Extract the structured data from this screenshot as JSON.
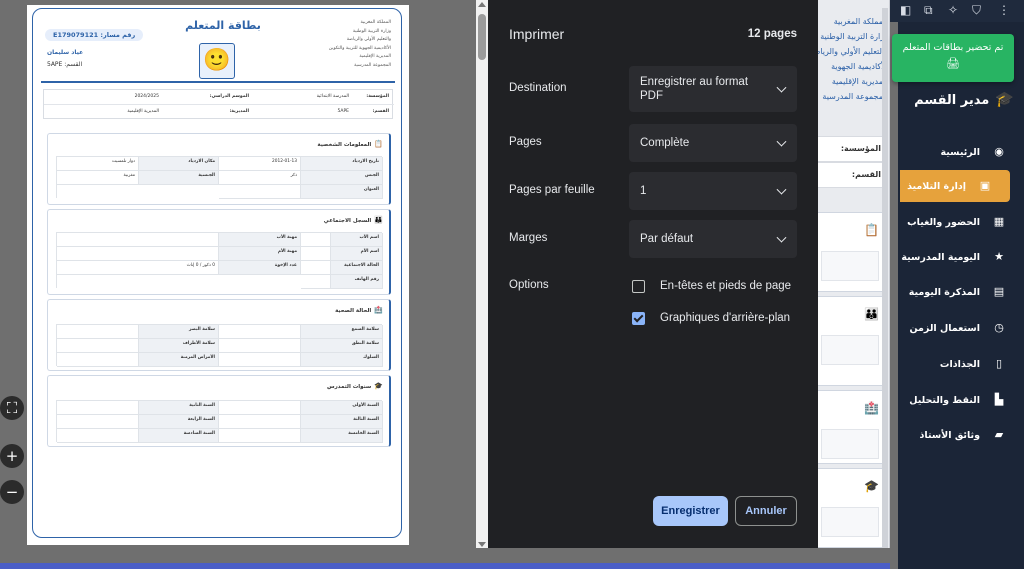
{
  "print_dialog": {
    "title": "Imprimer",
    "page_count": "12 pages",
    "destination_label": "Destination",
    "destination_value": "Enregistrer au format PDF",
    "pages_label": "Pages",
    "pages_value": "Complète",
    "pages_per_sheet_label": "Pages par feuille",
    "pages_per_sheet_value": "1",
    "margins_label": "Marges",
    "margins_value": "Par défaut",
    "options_label": "Options",
    "headers_footers_label": "En-têtes et pieds de page",
    "headers_footers_checked": false,
    "background_graphics_label": "Graphiques d'arrière-plan",
    "background_graphics_checked": true,
    "save_button": "Enregistrer",
    "cancel_button": "Annuler",
    "accent_color": "#a8c7fa"
  },
  "preview": {
    "zoom_in": "+",
    "zoom_out": "−",
    "fit": "⛶",
    "document": {
      "title": "بطاقة المتعلم",
      "registration": "رقم مسار: E179079121",
      "student_name": "عياد سليمان",
      "class_line": "القسم: 5APE",
      "ministry_lines": [
        "المملكة المغربية",
        "وزارة التربية الوطنية",
        "والتعليم الأولي والرياضة",
        "الأكاديمية الجهوية للتربية والتكوين",
        "المديرية الإقليمية",
        "المجموعة المدرسية"
      ],
      "info": {
        "school_label": "المؤسسة:",
        "school_value": "المدرسة الابتدائية",
        "year_label": "الموسم الدراسي:",
        "year_value": "2024/2025",
        "class_label": "القسم:",
        "class_value": "5APE",
        "direction_label": "المديرية:",
        "direction_value": "المديرية الإقليمية"
      },
      "sections": {
        "personal_title": "المعلومات الشخصية",
        "personal": [
          [
            "تاريخ الازدياد",
            "2012-01-13",
            "مكان الازدياد",
            "دوار تلمسيت"
          ],
          [
            "الجنس",
            "ذكر",
            "الجنسية",
            "مغربية"
          ],
          [
            "العنوان",
            "",
            "",
            ""
          ]
        ],
        "social_title": "السجل الاجتماعي",
        "social": [
          [
            "اسم الأب",
            "",
            "مهنة الأب",
            ""
          ],
          [
            "اسم الأم",
            "",
            "مهنة الأم",
            ""
          ],
          [
            "الحالة الاجتماعية",
            "",
            "عدد الإخوة",
            "0 ذكور / 0 إناث"
          ],
          [
            "رقم الهاتف",
            "",
            "",
            ""
          ]
        ],
        "health_title": "الحالة الصحية",
        "health": [
          [
            "سلامة السمع",
            "",
            "سلامة البصر",
            ""
          ],
          [
            "سلامة النطق",
            "",
            "سلامة الأطراف",
            ""
          ],
          [
            "السلوك",
            "",
            "الأمراض المزمنة",
            ""
          ]
        ],
        "schooling_title": "سنوات التمدرس",
        "schooling": [
          [
            "السنة الأولى",
            "",
            "السنة الثانية",
            ""
          ],
          [
            "السنة الثالثة",
            "",
            "السنة الرابعة",
            ""
          ],
          [
            "السنة الخامسة",
            "",
            "السنة السادسة",
            ""
          ]
        ]
      }
    }
  },
  "app": {
    "toast_text": "تم تحضير بطاقات المتعلم",
    "brand": "مدير القسم",
    "sidebar_items": [
      {
        "label": "الرئيسية",
        "icon": "dashboard-icon",
        "glyph": "◉"
      },
      {
        "label": "إدارة التلاميذ",
        "icon": "students-icon",
        "glyph": "▣",
        "active": true
      },
      {
        "label": "الحضور والغياب",
        "icon": "calendar-check-icon",
        "glyph": "▦"
      },
      {
        "label": "اليومية المدرسية",
        "icon": "star-icon",
        "glyph": "★"
      },
      {
        "label": "المذكرة اليومية",
        "icon": "notebook-icon",
        "glyph": "▤"
      },
      {
        "label": "استعمال الزمن",
        "icon": "clock-icon",
        "glyph": "◷"
      },
      {
        "label": "الجذاذات",
        "icon": "file-icon",
        "glyph": "▯"
      },
      {
        "label": "النقط والتحليل",
        "icon": "chart-icon",
        "glyph": "▙"
      },
      {
        "label": "وثائق الأستاذ",
        "icon": "folder-icon",
        "glyph": "▰"
      }
    ],
    "bg_header_lines": [
      "المملكة المغربية",
      "وزارة التربية الوطنية",
      "والتعليم الأولي والرياضة",
      "الأكاديمية الجهوية",
      "المديرية الإقليمية",
      "المجموعة المدرسية"
    ],
    "bg_school_label": "المؤسسة:",
    "bg_class_label": "القسم:",
    "sidebar_color": "#1b2537",
    "active_color": "#e6a23c",
    "toast_color": "#28b463"
  }
}
